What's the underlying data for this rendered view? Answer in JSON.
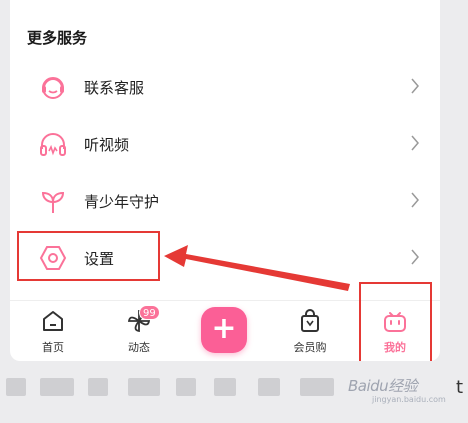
{
  "section": {
    "title": "更多服务"
  },
  "menu": [
    {
      "label": "联系客服",
      "icon": "headset-icon"
    },
    {
      "label": "听视频",
      "icon": "headphones-icon"
    },
    {
      "label": "青少年守护",
      "icon": "sprout-icon"
    },
    {
      "label": "设置",
      "icon": "gear-icon"
    }
  ],
  "tabbar": {
    "home": "首页",
    "dynamic": "动态",
    "dynamic_badge": "99",
    "plus": "+",
    "vip": "会员购",
    "mine": "我的"
  },
  "watermark": {
    "text": "Baidu经验",
    "sub": "jingyan.baidu.com"
  },
  "fragment": "t",
  "colors": {
    "accent": "#fb7299",
    "highlight": "#e53935"
  }
}
